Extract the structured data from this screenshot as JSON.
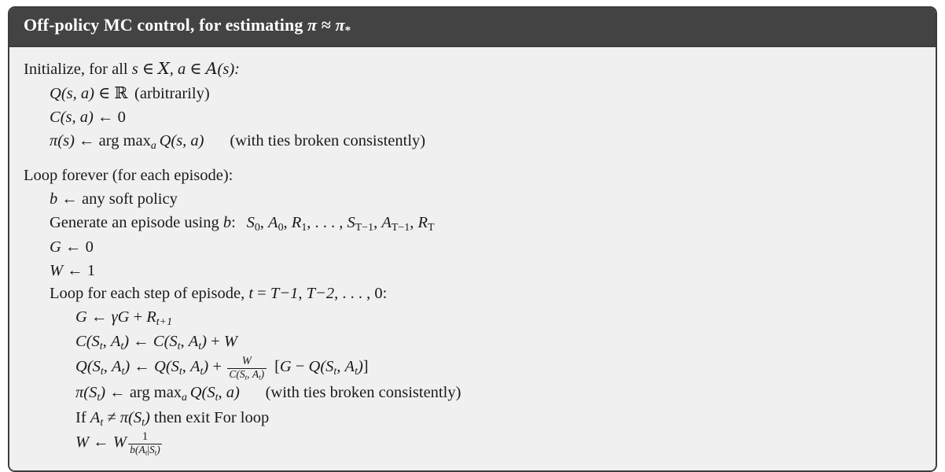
{
  "box": {
    "title_prefix": "Off-policy MC control, for estimating ",
    "title_math_pi": "π",
    "title_math_approx": " ≈ ",
    "title_math_pistar": "π",
    "title_star": "*"
  },
  "lines": {
    "l1": {
      "text_initialize": "Initialize, for all ",
      "s": "s",
      "in1": " ∈ ",
      "calS": "Χ",
      "comma": ", ",
      "a": "a",
      "in2": " ∈ ",
      "calA": "A",
      "paren_s": "(s):"
    },
    "l2": {
      "Q": "Q",
      "args": "(s, a)",
      "in": " ∈ ",
      "R": "ℝ",
      "note": "(arbitrarily)"
    },
    "l3": {
      "C": "C",
      "args": "(s, a)",
      "arrow": " ← ",
      "zero": "0"
    },
    "l4": {
      "pi": "π",
      "args": "(s)",
      "arrow": " ← ",
      "argmax": "arg max",
      "sub_a": "a",
      "Q": "Q",
      "Qargs": "(s, a)",
      "note": "(with ties broken consistently)"
    },
    "l5": {
      "text": "Loop forever (for each episode):"
    },
    "l6": {
      "b": "b",
      "arrow": " ← ",
      "text": "any soft policy"
    },
    "l7": {
      "text": "Generate an episode using ",
      "b": "b",
      "colon": ": ",
      "S0": "S",
      "S0sub": "0",
      "c1": ", ",
      "A0": "A",
      "A0sub": "0",
      "c2": ", ",
      "R1": "R",
      "R1sub": "1",
      "c3": ", . . . , ",
      "ST": "S",
      "STsub": "T−1",
      "c4": ", ",
      "AT": "A",
      "ATsub": "T−1",
      "c5": ", ",
      "RT": "R",
      "RTsub": "T"
    },
    "l8": {
      "G": "G",
      "arrow": " ← ",
      "zero": "0"
    },
    "l9": {
      "W": "W",
      "arrow": " ← ",
      "one": "1"
    },
    "l10": {
      "text": "Loop for each step of episode, ",
      "t": "t",
      "eq": " = ",
      "T1": "T−1",
      "c1": ", ",
      "T2": "T−2",
      "c2": ", . . . , ",
      "zero": "0:"
    },
    "l11": {
      "G": "G",
      "arrow": " ← ",
      "gamma": "γ",
      "G2": "G",
      "plus": " + ",
      "R": "R",
      "Rsub": "t+1"
    },
    "l12": {
      "C": "C",
      "lp": "(",
      "S": "S",
      "Ssub": "t",
      "cm": ", ",
      "A": "A",
      "Asub": "t",
      "rp": ")",
      "arrow": " ← ",
      "C2": "C",
      "plus": " + ",
      "W": "W"
    },
    "l13": {
      "Q": "Q",
      "lp": "(",
      "S": "S",
      "Ssub": "t",
      "cm": ", ",
      "A": "A",
      "Asub": "t",
      "rp": ")",
      "arrow": " ← ",
      "plus": " + ",
      "frac_num": "W",
      "frac_den_C": "C",
      "bracket_l": "[",
      "G": "G",
      "minus": " − ",
      "bracket_r": "]"
    },
    "l14": {
      "pi": "π",
      "lp": "(",
      "S": "S",
      "Ssub": "t",
      "rp": ")",
      "arrow": " ← ",
      "argmax": "arg max",
      "sub_a": "a",
      "Q": "Q",
      "Qlp": "(",
      "QS": "S",
      "QSsub": "t",
      "Qcm": ", ",
      "Qa": "a",
      "Qrp": ")",
      "note": "(with ties broken consistently)"
    },
    "l15": {
      "If": "If ",
      "A": "A",
      "Asub": "t",
      "neq": " ≠ ",
      "pi": "π",
      "lp": "(",
      "S": "S",
      "Ssub": "t",
      "rp": ")",
      "then": " then exit For loop"
    },
    "l16": {
      "W": "W",
      "arrow": " ← ",
      "W2": "W",
      "frac_num": "1",
      "frac_den_b": "b",
      "frac_den_A": "A",
      "frac_den_Asub": "t",
      "frac_den_bar": "|",
      "frac_den_S": "S",
      "frac_den_Ssub": "t"
    }
  }
}
